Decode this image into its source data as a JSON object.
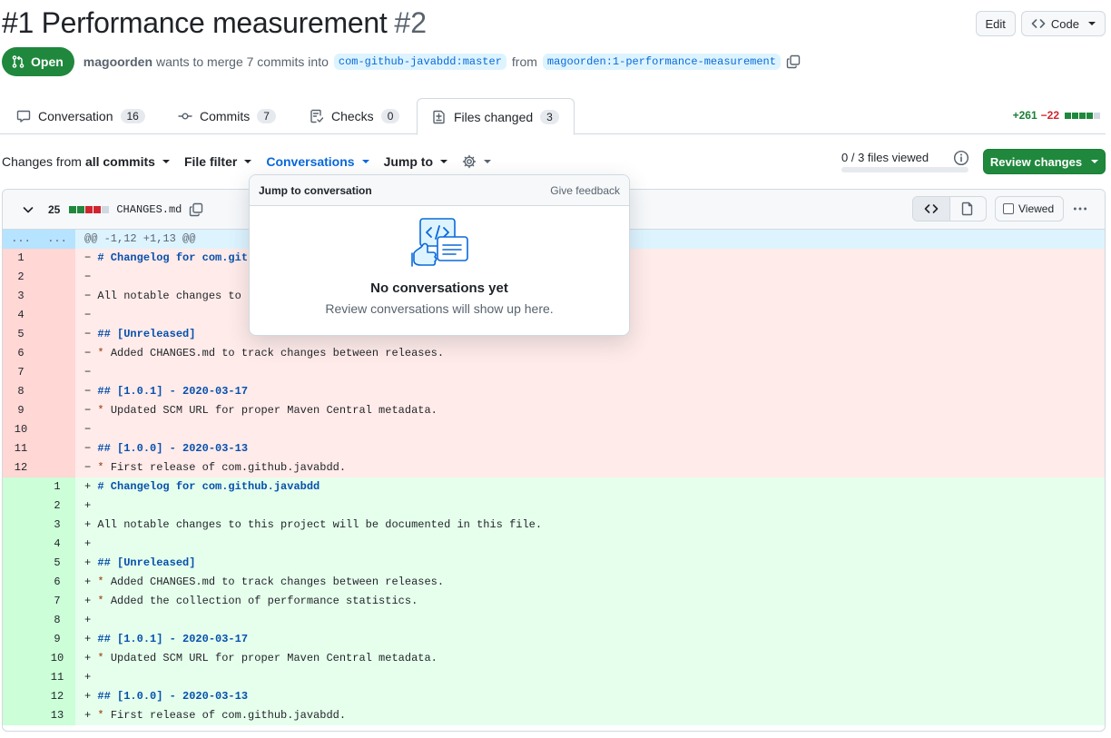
{
  "header": {
    "title": "#1 Performance measurement",
    "number": "#2",
    "edit_label": "Edit",
    "code_label": "Code"
  },
  "meta": {
    "state": "Open",
    "author": "magoorden",
    "text_merge": "wants to merge 7 commits into",
    "base_branch": "com-github-javabdd:master",
    "text_from": "from",
    "head_branch": "magoorden:1-performance-measurement"
  },
  "tabs": [
    {
      "label": "Conversation",
      "count": "16"
    },
    {
      "label": "Commits",
      "count": "7"
    },
    {
      "label": "Checks",
      "count": "0"
    },
    {
      "label": "Files changed",
      "count": "3"
    }
  ],
  "diffstat": {
    "additions": "+261",
    "deletions": "−22"
  },
  "toolbar": {
    "changes_prefix": "Changes from",
    "changes_value": "all commits",
    "file_filter": "File filter",
    "conversations": "Conversations",
    "jump_to": "Jump to",
    "files_viewed": "0 / 3 files viewed",
    "review_changes": "Review changes"
  },
  "file": {
    "change_count": "25",
    "name": "CHANGES.md",
    "viewed_label": "Viewed",
    "hunk": "@@ -1,12 +1,13 @@",
    "hunk_dots": "..."
  },
  "popup": {
    "heading": "Jump to conversation",
    "feedback": "Give feedback",
    "title": "No conversations yet",
    "subtitle": "Review conversations will show up here."
  },
  "deleted_lines": [
    {
      "n": "1",
      "sign": "−",
      "text": "# Changelog for com.git",
      "kind": "hdg"
    },
    {
      "n": "2",
      "sign": "−",
      "text": "",
      "kind": ""
    },
    {
      "n": "3",
      "sign": "−",
      "text": "All notable changes to",
      "kind": ""
    },
    {
      "n": "4",
      "sign": "−",
      "text": "",
      "kind": ""
    },
    {
      "n": "5",
      "sign": "−",
      "text": "## [Unreleased]",
      "kind": "hdg"
    },
    {
      "n": "6",
      "sign": "−",
      "text": "Added CHANGES.md to track changes between releases.",
      "kind": "bul"
    },
    {
      "n": "7",
      "sign": "−",
      "text": "",
      "kind": ""
    },
    {
      "n": "8",
      "sign": "−",
      "text": "## [1.0.1] - 2020-03-17",
      "kind": "hdg"
    },
    {
      "n": "9",
      "sign": "−",
      "text": "Updated SCM URL for proper Maven Central metadata.",
      "kind": "bul"
    },
    {
      "n": "10",
      "sign": "−",
      "text": "",
      "kind": ""
    },
    {
      "n": "11",
      "sign": "−",
      "text": "## [1.0.0] - 2020-03-13",
      "kind": "hdg"
    },
    {
      "n": "12",
      "sign": "−",
      "text": "First release of com.github.javabdd.",
      "kind": "bul"
    }
  ],
  "added_lines": [
    {
      "n": "1",
      "sign": "+",
      "text": "# Changelog for com.github.javabdd",
      "kind": "hdg"
    },
    {
      "n": "2",
      "sign": "+",
      "text": "",
      "kind": ""
    },
    {
      "n": "3",
      "sign": "+",
      "text": "All notable changes to this project will be documented in this file.",
      "kind": ""
    },
    {
      "n": "4",
      "sign": "+",
      "text": "",
      "kind": ""
    },
    {
      "n": "5",
      "sign": "+",
      "text": "## [Unreleased]",
      "kind": "hdg"
    },
    {
      "n": "6",
      "sign": "+",
      "text": "Added CHANGES.md to track changes between releases.",
      "kind": "bul"
    },
    {
      "n": "7",
      "sign": "+",
      "text": "Added the collection of performance statistics.",
      "kind": "bul"
    },
    {
      "n": "8",
      "sign": "+",
      "text": "",
      "kind": ""
    },
    {
      "n": "9",
      "sign": "+",
      "text": "## [1.0.1] - 2020-03-17",
      "kind": "hdg"
    },
    {
      "n": "10",
      "sign": "+",
      "text": "Updated SCM URL for proper Maven Central metadata.",
      "kind": "bul"
    },
    {
      "n": "11",
      "sign": "+",
      "text": "",
      "kind": ""
    },
    {
      "n": "12",
      "sign": "+",
      "text": "## [1.0.0] - 2020-03-13",
      "kind": "hdg"
    },
    {
      "n": "13",
      "sign": "+",
      "text": "First release of com.github.javabdd.",
      "kind": "bul"
    }
  ],
  "colors": {
    "accent": "#0969da",
    "success": "#1f883d",
    "danger": "#d1242f"
  }
}
